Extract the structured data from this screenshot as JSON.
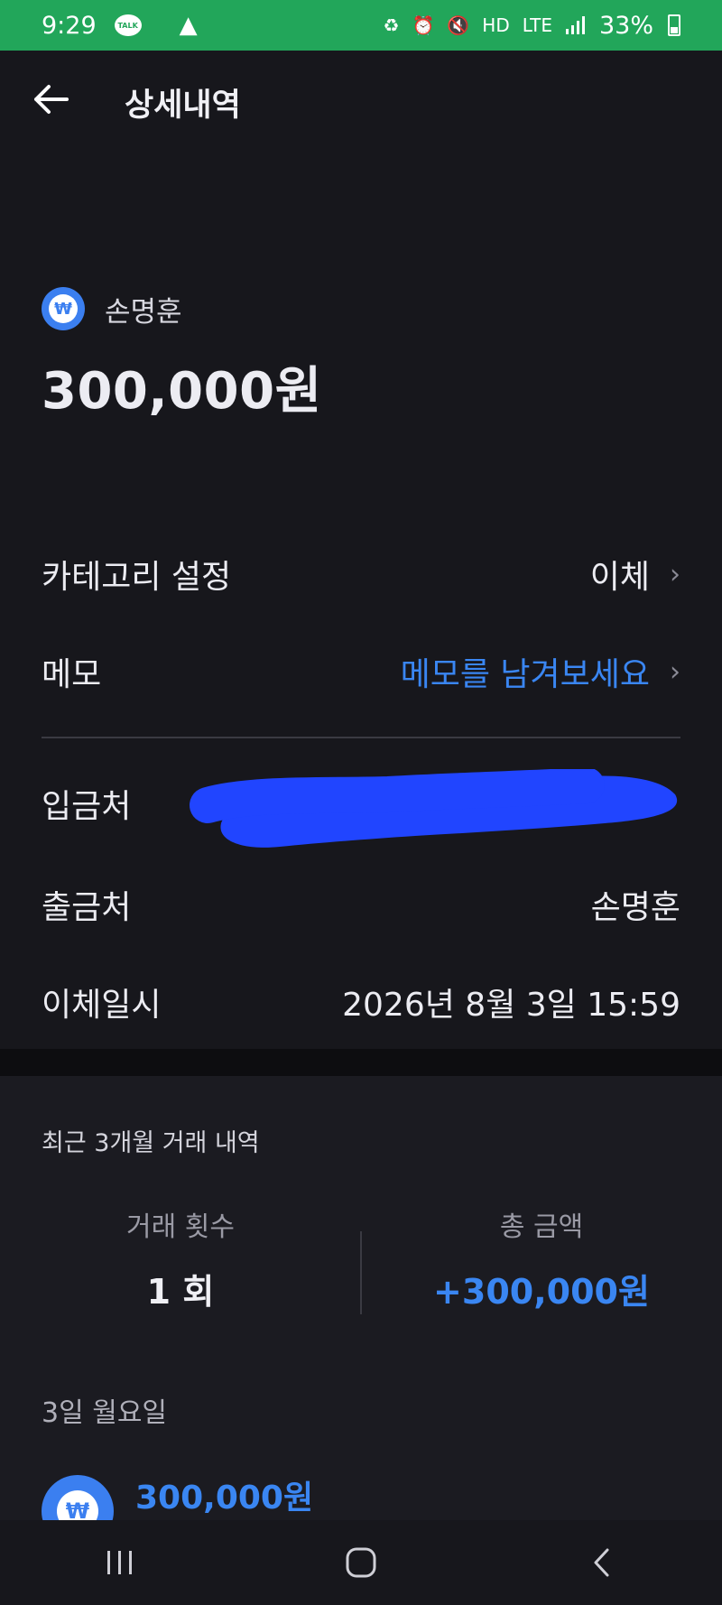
{
  "status_bar": {
    "time": "9:29",
    "talk_icon_label": "TALK",
    "network": "LTE",
    "hd": "HD",
    "battery": "33%",
    "battery_level": 0.33
  },
  "header": {
    "title": "상세내역"
  },
  "summary": {
    "name": "손명훈",
    "amount": "300,000원",
    "icon": "won-icon",
    "icon_color": "#3b7ff0"
  },
  "details": {
    "category_label": "카테고리 설정",
    "category_value": "이체",
    "memo_label": "메모",
    "memo_placeholder": "메모를 남겨보세요",
    "deposit_label": "입금처",
    "withdraw_label": "출금처",
    "withdraw_value": "손명훈",
    "datetime_label": "이체일시",
    "datetime_value": "2026년 8월 3일 15:59"
  },
  "recent": {
    "title": "최근 3개월 거래 내역",
    "count_label": "거래 횟수",
    "count_value": "1 회",
    "total_label": "총 금액",
    "total_value": "+300,000원",
    "date_group": "3일 월요일",
    "transaction_amount": "300,000원"
  },
  "colors": {
    "accent_blue": "#3a86f2",
    "status_bar_green": "#22a65a",
    "background": "#17171c"
  }
}
